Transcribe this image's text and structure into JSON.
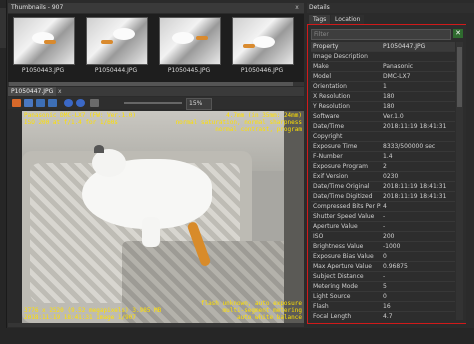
{
  "thumbnails": {
    "title": "Thumbnails - 907",
    "close": "x",
    "items": [
      {
        "label": "P1050443.JPG"
      },
      {
        "label": "P1050444.JPG"
      },
      {
        "label": "P1050445.JPG"
      },
      {
        "label": "P1050446.JPG"
      }
    ]
  },
  "viewer": {
    "tab": "P1050447.JPG",
    "close": "x",
    "zoom": "15%",
    "overlay": {
      "top_left": "Panasonic DMC-LX7 (FW: Ver.1.0)\nISO 200 at f/1.4 for 1/60s",
      "top_right": "4.7mm (in 35mm: 24mm)\nnormal saturation, normal sharpness\nnormal contrast, program",
      "bottom_left": "3776 x 2520 (9.52 megapixels) 3.985 MB\n2018:11:19 18:41:31 Image 1/907",
      "bottom_right": "flash unknown, auto exposure\nmulti-segment metering\nauto white balance"
    }
  },
  "details": {
    "title": "Details",
    "tabs": [
      "Tags",
      "Location"
    ],
    "filter_placeholder": "Filter",
    "columns": {
      "property": "Property",
      "value": "P1050447.JPG"
    },
    "rows": [
      {
        "k": "Image Description",
        "v": ""
      },
      {
        "k": "Make",
        "v": "Panasonic"
      },
      {
        "k": "Model",
        "v": "DMC-LX7"
      },
      {
        "k": "Orientation",
        "v": "1"
      },
      {
        "k": "X Resolution",
        "v": "180"
      },
      {
        "k": "Y Resolution",
        "v": "180"
      },
      {
        "k": "Software",
        "v": "Ver.1.0"
      },
      {
        "k": "Date/Time",
        "v": "2018:11:19 18:41:31"
      },
      {
        "k": "Copyright",
        "v": ""
      },
      {
        "k": "Exposure Time",
        "v": "8333/500000 sec"
      },
      {
        "k": "F-Number",
        "v": "1.4"
      },
      {
        "k": "Exposure Program",
        "v": "2"
      },
      {
        "k": "Exif Version",
        "v": "0230"
      },
      {
        "k": "Date/Time Original",
        "v": "2018:11:19 18:41:31"
      },
      {
        "k": "Date/Time Digitized",
        "v": "2018:11:19 18:41:31"
      },
      {
        "k": "Compressed Bits Per Pixel",
        "v": "4"
      },
      {
        "k": "Shutter Speed Value",
        "v": "-"
      },
      {
        "k": "Aperture Value",
        "v": "-"
      },
      {
        "k": "ISO",
        "v": "200"
      },
      {
        "k": "Brightness Value",
        "v": "-1000"
      },
      {
        "k": "Exposure Bias Value",
        "v": "0"
      },
      {
        "k": "Max Aperture Value",
        "v": "0.96875"
      },
      {
        "k": "Subject Distance",
        "v": "-"
      },
      {
        "k": "Metering Mode",
        "v": "5"
      },
      {
        "k": "Light Source",
        "v": "0"
      },
      {
        "k": "Flash",
        "v": "16"
      },
      {
        "k": "Focal Length",
        "v": "4.7"
      }
    ]
  }
}
